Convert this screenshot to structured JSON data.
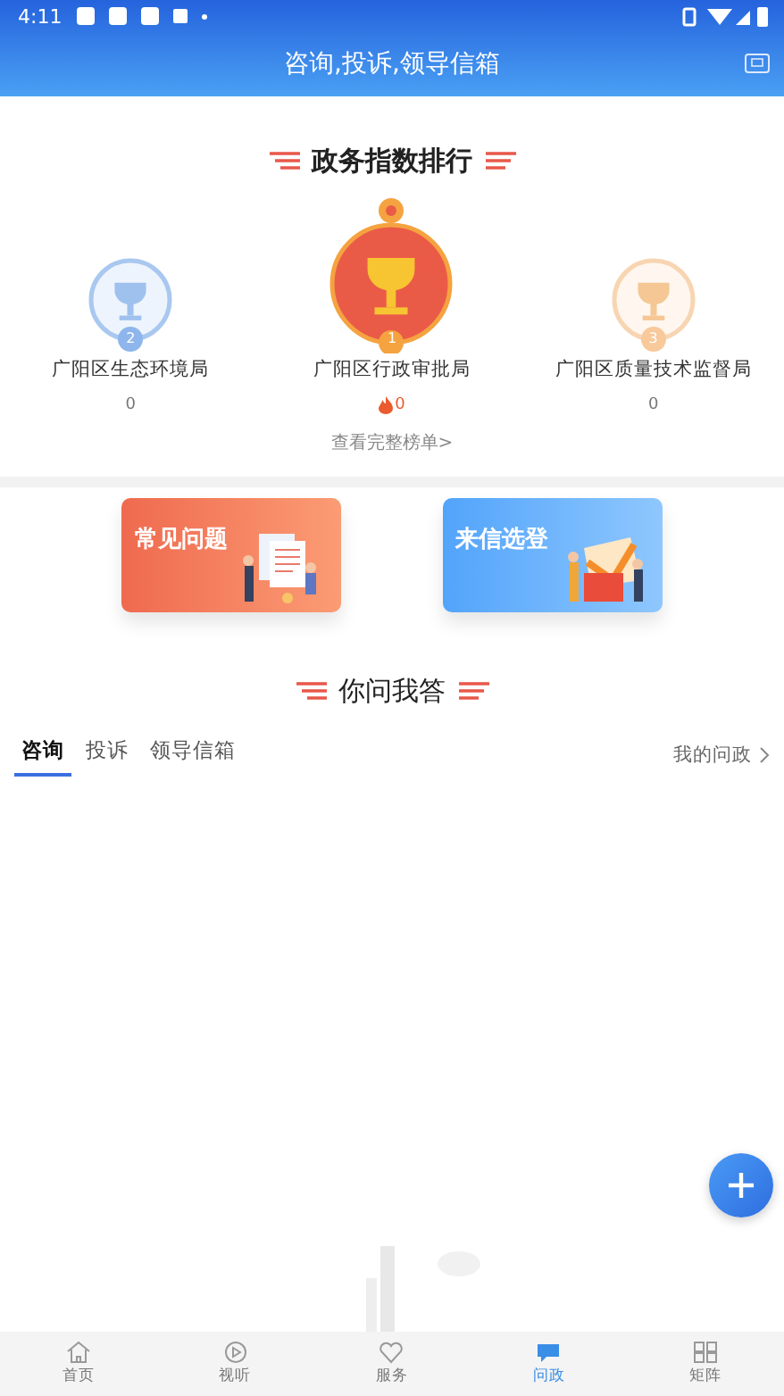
{
  "status_bar": {
    "time": "4:11"
  },
  "header": {
    "title": "咨询,投诉,领导信箱"
  },
  "ranking": {
    "title": "政务指数排行",
    "items": [
      {
        "rank": "2",
        "name": "广阳区生态环境局",
        "score": "0",
        "kind": "silver",
        "hot": false
      },
      {
        "rank": "1",
        "name": "广阳区行政审批局",
        "score": "0",
        "kind": "gold",
        "hot": true
      },
      {
        "rank": "3",
        "name": "广阳区质量技术监督局",
        "score": "0",
        "kind": "bronze",
        "hot": false
      }
    ],
    "more_link": "查看完整榜单>"
  },
  "banners": [
    {
      "label": "常见问题",
      "kind": "faq"
    },
    {
      "label": "来信选登",
      "kind": "letters"
    }
  ],
  "qa": {
    "title": "你问我答",
    "tabs": [
      {
        "label": "咨询",
        "selected": true
      },
      {
        "label": "投诉",
        "selected": false
      },
      {
        "label": "领导信箱",
        "selected": false
      }
    ],
    "my_link": "我的问政"
  },
  "bottom_nav": [
    {
      "label": "首页",
      "kind": "home",
      "selected": false
    },
    {
      "label": "视听",
      "kind": "play",
      "selected": false
    },
    {
      "label": "服务",
      "kind": "heart",
      "selected": false
    },
    {
      "label": "问政",
      "kind": "chat",
      "selected": true
    },
    {
      "label": "矩阵",
      "kind": "grid",
      "selected": false
    }
  ]
}
